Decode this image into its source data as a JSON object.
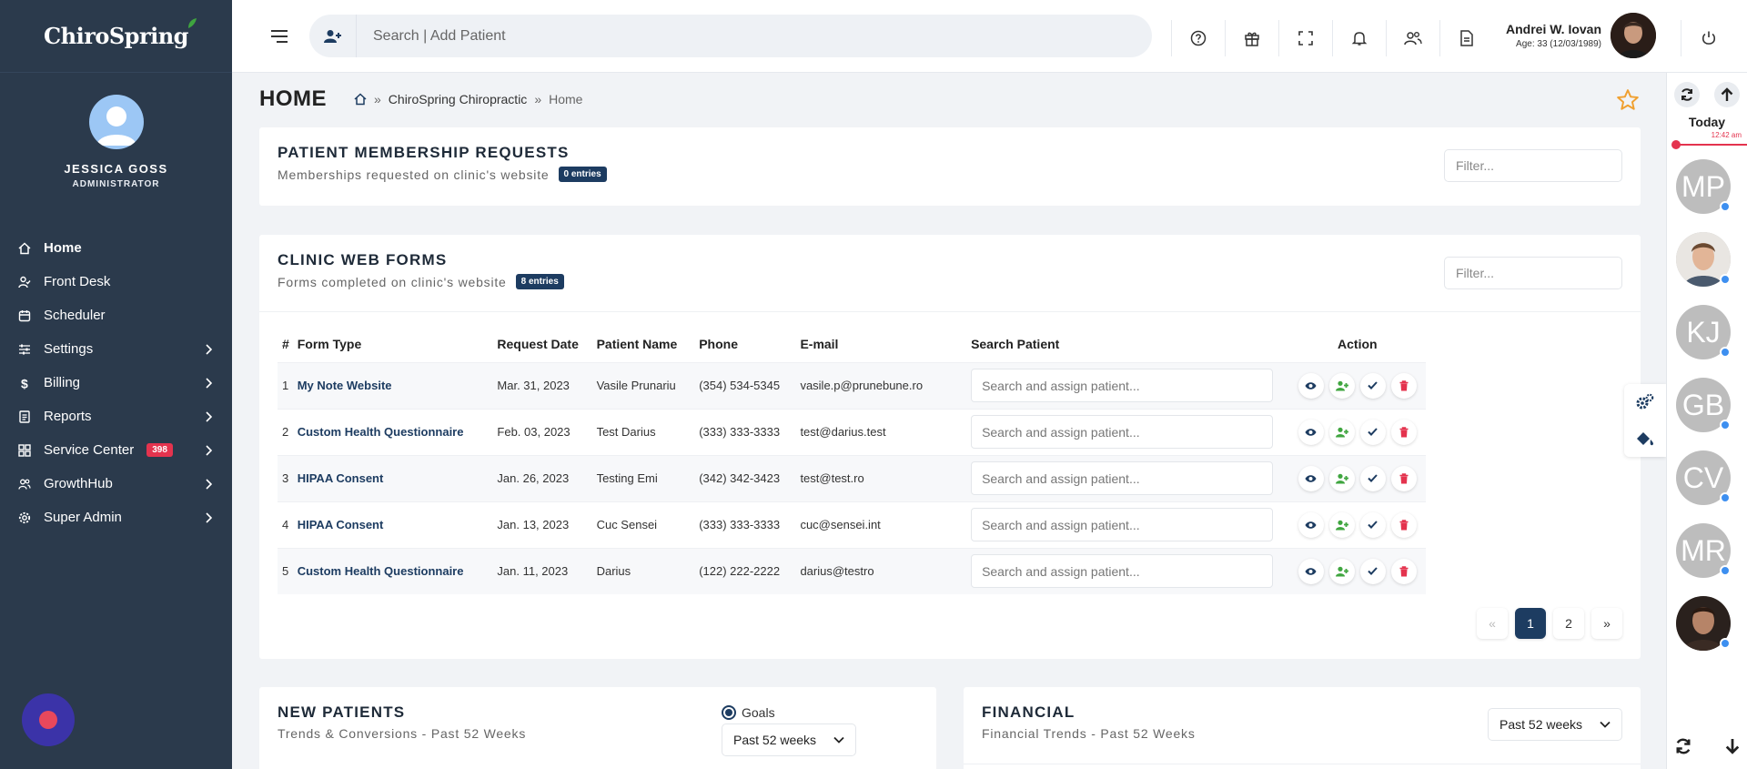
{
  "app": {
    "brand": "ChiroSpring"
  },
  "sidebar": {
    "profile": {
      "name": "JESSICA GOSS",
      "role": "ADMINISTRATOR"
    },
    "items": [
      {
        "label": "Home",
        "icon": "home-icon",
        "active": true,
        "chevron": false
      },
      {
        "label": "Front Desk",
        "icon": "user-check-icon",
        "chevron": false
      },
      {
        "label": "Scheduler",
        "icon": "calendar-icon",
        "chevron": false
      },
      {
        "label": "Settings",
        "icon": "sliders-icon",
        "chevron": true
      },
      {
        "label": "Billing",
        "icon": "dollar-icon",
        "chevron": true
      },
      {
        "label": "Reports",
        "icon": "report-icon",
        "chevron": true
      },
      {
        "label": "Service Center",
        "icon": "grid-icon",
        "chevron": true,
        "badge": "398"
      },
      {
        "label": "GrowthHub",
        "icon": "users-icon",
        "chevron": true
      },
      {
        "label": "Super Admin",
        "icon": "gear-icon",
        "chevron": true
      }
    ]
  },
  "topbar": {
    "search_placeholder": "Search | Add Patient",
    "user": {
      "name": "Andrei W. Iovan",
      "age": "Age: 33 (12/03/1989)"
    }
  },
  "page": {
    "title": "HOME",
    "breadcrumb": [
      "ChiroSpring Chiropractic",
      "Home"
    ]
  },
  "membership": {
    "title": "PATIENT MEMBERSHIP REQUESTS",
    "subtitle": "Memberships requested on clinic's website",
    "entries": "0 entries",
    "filter_placeholder": "Filter..."
  },
  "webforms": {
    "title": "CLINIC WEB FORMS",
    "subtitle": "Forms completed on clinic's website",
    "entries": "8 entries",
    "filter_placeholder": "Filter...",
    "columns": [
      "#",
      "Form Type",
      "Request Date",
      "Patient Name",
      "Phone",
      "E-mail",
      "Search Patient",
      "Action"
    ],
    "assign_placeholder": "Search and assign patient...",
    "rows": [
      {
        "num": "1",
        "form": "My Note Website",
        "date": "Mar. 31, 2023",
        "patient": "Vasile Prunariu",
        "phone": "(354) 534-5345",
        "email": "vasile.p@prunebune.ro"
      },
      {
        "num": "2",
        "form": "Custom Health Questionnaire",
        "date": "Feb. 03, 2023",
        "patient": "Test Darius",
        "phone": "(333) 333-3333",
        "email": "test@darius.test"
      },
      {
        "num": "3",
        "form": "HIPAA Consent",
        "date": "Jan. 26, 2023",
        "patient": "Testing Emi",
        "phone": "(342) 342-3423",
        "email": "test@test.ro"
      },
      {
        "num": "4",
        "form": "HIPAA Consent",
        "date": "Jan. 13, 2023",
        "patient": "Cuc Sensei",
        "phone": "(333) 333-3333",
        "email": "cuc@sensei.int"
      },
      {
        "num": "5",
        "form": "Custom Health Questionnaire",
        "date": "Jan. 11, 2023",
        "patient": "Darius",
        "phone": "(122) 222-2222",
        "email": "darius@testro"
      }
    ],
    "pagination": {
      "prev": "«",
      "pages": [
        "1",
        "2"
      ],
      "current": "1",
      "next": "»"
    }
  },
  "new_patients": {
    "title": "NEW PATIENTS",
    "subtitle": "Trends & Conversions - Past 52 Weeks",
    "goals_label": "Goals",
    "range": "Past 52 weeks"
  },
  "financial": {
    "title": "FINANCIAL",
    "subtitle": "Financial Trends - Past 52 Weeks",
    "range": "Past 52 weeks"
  },
  "rail": {
    "today": "Today",
    "time": "12:42 am",
    "avatars": [
      {
        "initials": "MP",
        "photo": false
      },
      {
        "initials": "",
        "photo": true
      },
      {
        "initials": "KJ",
        "photo": false
      },
      {
        "initials": "GB",
        "photo": false
      },
      {
        "initials": "CV",
        "photo": false
      },
      {
        "initials": "MR",
        "photo": false
      },
      {
        "initials": "",
        "photo": true
      }
    ]
  },
  "colors": {
    "sidebar": "#2b3a4c",
    "accent": "#1d3c61",
    "danger": "#e4334e",
    "success": "#3fa53f"
  }
}
